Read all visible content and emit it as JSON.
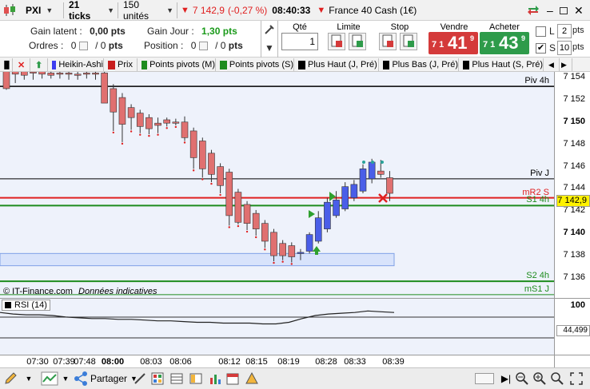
{
  "topbar": {
    "market_code": "PXI",
    "period": "21 ticks",
    "units": "150 unités",
    "price": "7 142,9",
    "change": "(-0,27 %)",
    "time": "08:40:33",
    "instrument": "France 40 Cash (1€)"
  },
  "panel": {
    "latent_label": "Gain latent :",
    "latent_value": "0,00 pts",
    "jour_label": "Gain Jour :",
    "jour_value": "1,30 pts",
    "orders_label": "Ordres :",
    "orders_a": "0",
    "orders_b": "0",
    "position_label": "Position :",
    "position_a": "0",
    "position_b": "0",
    "qty_label": "Qté",
    "qty_value": "1",
    "limit_label": "Limite",
    "stop_label": "Stop",
    "sell_label": "Vendre",
    "sell_prefix": "7 1",
    "sell_big": "41",
    "sell_sup": "9",
    "buy_label": "Acheter",
    "buy_prefix": "7 1",
    "buy_big": "43",
    "buy_sup": "9",
    "l_label": "L",
    "l_value": "2",
    "l_unit": "pts",
    "s_label": "S",
    "s_value": "10",
    "s_unit": "pts"
  },
  "tabs": [
    {
      "label": "Heikin-Ashi",
      "color": "#3c3cf0"
    },
    {
      "label": "Prix",
      "color": "#c81e1e"
    },
    {
      "label": "Points pivots (M)",
      "color": "#1e8c1e"
    },
    {
      "label": "Points pivots (S)",
      "color": "#1e8c1e"
    },
    {
      "label": "Plus Haut (J, Pré)",
      "color": "#000000"
    },
    {
      "label": "Plus Bas (J, Pré)",
      "color": "#000000"
    },
    {
      "label": "Plus Haut (S, Pré)",
      "color": "#000000"
    }
  ],
  "chart_data": {
    "type": "candlestick",
    "price_ticks": [
      "7 154",
      "7 152",
      "7 150",
      "7 148",
      "7 146",
      "7 144",
      "7 142",
      "7 140",
      "7 138",
      "7 136"
    ],
    "bold_ticks": [
      "7 150",
      "7 140"
    ],
    "current_price_label": "7 142,9",
    "levels": [
      {
        "label": "Piv 4h",
        "value": 7153.2
      },
      {
        "label": "Piv J",
        "value": 7144.9
      },
      {
        "label": "mR2 S",
        "value": 7143.2
      },
      {
        "label": "S1 4h",
        "value": 7142.5
      },
      {
        "label": "S2 4h",
        "value": 7135.7
      },
      {
        "label": "mS1 J",
        "value": 7134.5
      }
    ],
    "candles": [
      {
        "o": 7155.5,
        "h": 7156.0,
        "l": 7152.9,
        "c": 7153.0,
        "bull": false
      },
      {
        "o": 7155.0,
        "h": 7155.2,
        "l": 7153.5,
        "c": 7154.3,
        "bull": false
      },
      {
        "o": 7154.8,
        "h": 7155.0,
        "l": 7153.8,
        "c": 7154.2,
        "bull": false
      },
      {
        "o": 7154.5,
        "h": 7154.8,
        "l": 7153.8,
        "c": 7154.4,
        "bull": false
      },
      {
        "o": 7154.6,
        "h": 7155.0,
        "l": 7153.9,
        "c": 7154.3,
        "bull": false
      },
      {
        "o": 7154.4,
        "h": 7155.0,
        "l": 7153.9,
        "c": 7154.2,
        "bull": false
      },
      {
        "o": 7154.4,
        "h": 7155.0,
        "l": 7153.9,
        "c": 7154.3,
        "bull": false
      },
      {
        "o": 7154.4,
        "h": 7155.0,
        "l": 7153.8,
        "c": 7154.3,
        "bull": false
      },
      {
        "o": 7154.3,
        "h": 7155.0,
        "l": 7153.8,
        "c": 7154.3,
        "bull": false
      },
      {
        "o": 7154.3,
        "h": 7155.0,
        "l": 7153.9,
        "c": 7154.4,
        "bull": false
      },
      {
        "o": 7154.3,
        "h": 7155.0,
        "l": 7153.8,
        "c": 7154.4,
        "bull": false
      },
      {
        "o": 7154.4,
        "h": 7155.0,
        "l": 7152.0,
        "c": 7151.7,
        "bull": false
      },
      {
        "o": 7153.0,
        "h": 7153.4,
        "l": 7149.2,
        "c": 7150.9,
        "bull": false
      },
      {
        "o": 7152.2,
        "h": 7152.6,
        "l": 7148.2,
        "c": 7149.8,
        "bull": false
      },
      {
        "o": 7151.3,
        "h": 7151.6,
        "l": 7149.3,
        "c": 7150.4,
        "bull": false
      },
      {
        "o": 7150.8,
        "h": 7151.1,
        "l": 7149.0,
        "c": 7149.6,
        "bull": false
      },
      {
        "o": 7150.4,
        "h": 7150.7,
        "l": 7148.9,
        "c": 7149.4,
        "bull": false
      },
      {
        "o": 7149.9,
        "h": 7150.4,
        "l": 7149.0,
        "c": 7149.7,
        "bull": false
      },
      {
        "o": 7149.9,
        "h": 7150.4,
        "l": 7149.6,
        "c": 7150.2,
        "bull": false
      },
      {
        "o": 7150.0,
        "h": 7150.3,
        "l": 7149.7,
        "c": 7150.0,
        "bull": false
      },
      {
        "o": 7150.0,
        "h": 7150.5,
        "l": 7148.3,
        "c": 7148.6,
        "bull": false
      },
      {
        "o": 7149.2,
        "h": 7149.5,
        "l": 7145.8,
        "c": 7146.8,
        "bull": false
      },
      {
        "o": 7148.3,
        "h": 7148.6,
        "l": 7145.0,
        "c": 7145.8,
        "bull": false
      },
      {
        "o": 7147.2,
        "h": 7147.5,
        "l": 7144.6,
        "c": 7145.3,
        "bull": false
      },
      {
        "o": 7146.0,
        "h": 7146.3,
        "l": 7143.6,
        "c": 7144.3,
        "bull": false
      },
      {
        "o": 7145.5,
        "h": 7145.8,
        "l": 7140.7,
        "c": 7141.6,
        "bull": false
      },
      {
        "o": 7143.7,
        "h": 7144.0,
        "l": 7140.8,
        "c": 7141.0,
        "bull": false
      },
      {
        "o": 7142.6,
        "h": 7142.9,
        "l": 7140.3,
        "c": 7140.9,
        "bull": false
      },
      {
        "o": 7141.8,
        "h": 7142.1,
        "l": 7139.8,
        "c": 7140.4,
        "bull": false
      },
      {
        "o": 7140.9,
        "h": 7141.2,
        "l": 7138.7,
        "c": 7139.3,
        "bull": false
      },
      {
        "o": 7140.1,
        "h": 7140.4,
        "l": 7137.5,
        "c": 7138.0,
        "bull": false
      },
      {
        "o": 7139.1,
        "h": 7139.4,
        "l": 7137.6,
        "c": 7138.0,
        "bull": false
      },
      {
        "o": 7138.9,
        "h": 7139.2,
        "l": 7137.4,
        "c": 7137.9,
        "bull": false
      },
      {
        "o": 7138.2,
        "h": 7138.6,
        "l": 7137.6,
        "c": 7138.3,
        "bull": true
      },
      {
        "o": 7138.4,
        "h": 7140.1,
        "l": 7138.2,
        "c": 7139.9,
        "bull": true
      },
      {
        "o": 7139.3,
        "h": 7142.0,
        "l": 7139.1,
        "c": 7141.4,
        "bull": true
      },
      {
        "o": 7140.4,
        "h": 7143.2,
        "l": 7140.1,
        "c": 7142.8,
        "bull": true
      },
      {
        "o": 7141.6,
        "h": 7143.8,
        "l": 7141.4,
        "c": 7143.0,
        "bull": true
      },
      {
        "o": 7142.2,
        "h": 7144.6,
        "l": 7142.0,
        "c": 7144.2,
        "bull": true
      },
      {
        "o": 7143.2,
        "h": 7144.8,
        "l": 7142.9,
        "c": 7144.4,
        "bull": true
      },
      {
        "o": 7143.8,
        "h": 7146.2,
        "l": 7143.6,
        "c": 7145.8,
        "bull": true
      },
      {
        "o": 7144.9,
        "h": 7146.7,
        "l": 7144.5,
        "c": 7146.4,
        "bull": true
      },
      {
        "o": 7145.6,
        "h": 7146.6,
        "l": 7145.0,
        "c": 7145.3,
        "bull": false
      },
      {
        "o": 7145.0,
        "h": 7145.6,
        "l": 7142.9,
        "c": 7143.6,
        "bull": false
      }
    ],
    "target_zone": {
      "high": 7138.2,
      "low": 7137.1
    },
    "rsi": {
      "label": "RSI (14)",
      "top_tick": "100",
      "value_label": "44,499",
      "values": [
        44,
        42,
        41,
        41,
        40,
        38,
        37,
        36,
        36,
        35,
        35,
        34,
        33,
        33,
        32,
        31,
        31,
        30,
        30,
        30,
        29,
        29,
        31,
        36,
        40,
        42,
        43,
        44,
        46,
        45,
        44
      ]
    },
    "time_labels": [
      {
        "t": "07:30",
        "bold": false
      },
      {
        "t": "07:39",
        "bold": false
      },
      {
        "t": "07:48",
        "bold": false
      },
      {
        "t": "08:00",
        "bold": true
      },
      {
        "t": "08:03",
        "bold": false
      },
      {
        "t": "08:06",
        "bold": false
      },
      {
        "t": "08:12",
        "bold": false
      },
      {
        "t": "08:15",
        "bold": false
      },
      {
        "t": "08:19",
        "bold": false
      },
      {
        "t": "08:28",
        "bold": false
      },
      {
        "t": "08:33",
        "bold": false
      },
      {
        "t": "08:39",
        "bold": false
      }
    ]
  },
  "chart_footer": {
    "source": "© IT-Finance.com",
    "note": "Données indicatives"
  },
  "bottom": {
    "share_label": "Partager"
  },
  "colors": {
    "bull": "#4a5ee8",
    "bear": "#e07070",
    "accent_red": "#e02020",
    "green": "#1e8c1e",
    "sell_bg": "#d43a3a",
    "buy_bg": "#2e9b4a"
  }
}
